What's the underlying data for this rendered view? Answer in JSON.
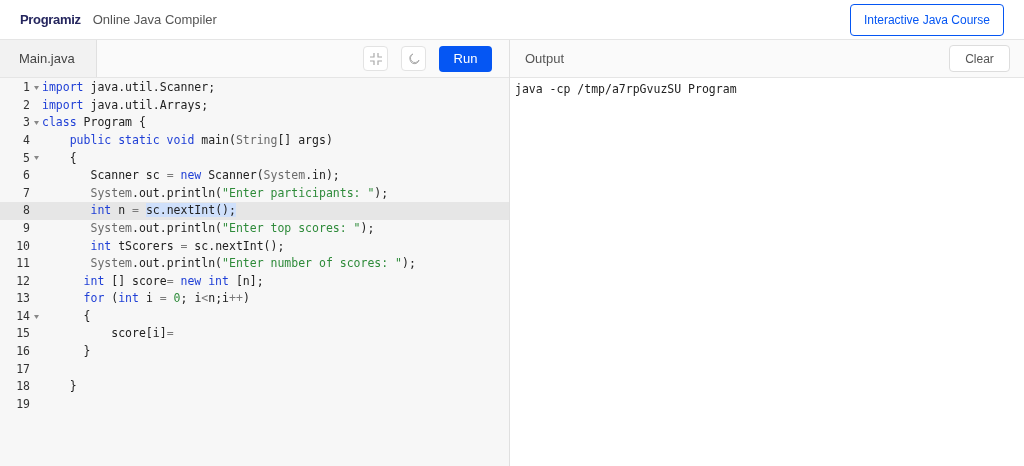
{
  "header": {
    "logo": "Programiz",
    "title": "Online Java Compiler",
    "course_button": "Interactive Java Course"
  },
  "editor": {
    "tab": "Main.java",
    "run_button": "Run",
    "lines": [
      {
        "number": "1",
        "foldable": true,
        "active": false,
        "tokens": [
          {
            "kind": "keyword",
            "text": "import"
          },
          {
            "kind": "plain",
            "text": " java.util.Scanner;"
          }
        ]
      },
      {
        "number": "2",
        "foldable": false,
        "active": false,
        "tokens": [
          {
            "kind": "keyword",
            "text": "import"
          },
          {
            "kind": "plain",
            "text": " java.util.Arrays;"
          }
        ]
      },
      {
        "number": "3",
        "foldable": true,
        "active": false,
        "tokens": [
          {
            "kind": "keyword",
            "text": "class"
          },
          {
            "kind": "plain",
            "text": " Program {"
          }
        ]
      },
      {
        "number": "4",
        "foldable": false,
        "active": false,
        "tokens": [
          {
            "kind": "keyword",
            "text": "    public static void"
          },
          {
            "kind": "plain",
            "text": " main("
          },
          {
            "kind": "builtin",
            "text": "String"
          },
          {
            "kind": "plain",
            "text": "[] args)"
          }
        ]
      },
      {
        "number": "5",
        "foldable": true,
        "active": false,
        "tokens": [
          {
            "kind": "plain",
            "text": "    {"
          }
        ]
      },
      {
        "number": "6",
        "foldable": false,
        "active": false,
        "tokens": [
          {
            "kind": "plain",
            "text": "       Scanner sc "
          },
          {
            "kind": "operator",
            "text": "= "
          },
          {
            "kind": "keyword",
            "text": "new"
          },
          {
            "kind": "plain",
            "text": " Scanner("
          },
          {
            "kind": "builtin",
            "text": "System"
          },
          {
            "kind": "plain",
            "text": ".in);"
          }
        ]
      },
      {
        "number": "7",
        "foldable": false,
        "active": false,
        "tokens": [
          {
            "kind": "builtin",
            "text": "       System"
          },
          {
            "kind": "plain",
            "text": ".out.println("
          },
          {
            "kind": "string",
            "text": "\"Enter participants: \""
          },
          {
            "kind": "plain",
            "text": ");"
          }
        ]
      },
      {
        "number": "8",
        "foldable": false,
        "active": true,
        "tokens": [
          {
            "kind": "keyword",
            "text": "       int"
          },
          {
            "kind": "plain",
            "text": " n "
          },
          {
            "kind": "operator",
            "text": "= "
          },
          {
            "kind": "selection",
            "text": "sc.nextInt();"
          }
        ]
      },
      {
        "number": "9",
        "foldable": false,
        "active": false,
        "tokens": [
          {
            "kind": "builtin",
            "text": "       System"
          },
          {
            "kind": "plain",
            "text": ".out.println("
          },
          {
            "kind": "string",
            "text": "\"Enter top scores: \""
          },
          {
            "kind": "plain",
            "text": ");"
          }
        ]
      },
      {
        "number": "10",
        "foldable": false,
        "active": false,
        "tokens": [
          {
            "kind": "keyword",
            "text": "       int"
          },
          {
            "kind": "plain",
            "text": " tScorers "
          },
          {
            "kind": "operator",
            "text": "="
          },
          {
            "kind": "plain",
            "text": " sc.nextInt();"
          }
        ]
      },
      {
        "number": "11",
        "foldable": false,
        "active": false,
        "tokens": [
          {
            "kind": "builtin",
            "text": "       System"
          },
          {
            "kind": "plain",
            "text": ".out.println("
          },
          {
            "kind": "string",
            "text": "\"Enter number of scores: \""
          },
          {
            "kind": "plain",
            "text": ");"
          }
        ]
      },
      {
        "number": "12",
        "foldable": false,
        "active": false,
        "tokens": [
          {
            "kind": "keyword",
            "text": "      int"
          },
          {
            "kind": "plain",
            "text": " [] score"
          },
          {
            "kind": "operator",
            "text": "= "
          },
          {
            "kind": "keyword",
            "text": "new int"
          },
          {
            "kind": "plain",
            "text": " [n];"
          }
        ]
      },
      {
        "number": "13",
        "foldable": false,
        "active": false,
        "tokens": [
          {
            "kind": "keyword",
            "text": "      for"
          },
          {
            "kind": "plain",
            "text": " ("
          },
          {
            "kind": "keyword",
            "text": "int"
          },
          {
            "kind": "plain",
            "text": " i "
          },
          {
            "kind": "operator",
            "text": "= "
          },
          {
            "kind": "string",
            "text": "0"
          },
          {
            "kind": "plain",
            "text": "; i"
          },
          {
            "kind": "operator",
            "text": "<"
          },
          {
            "kind": "plain",
            "text": "n;i"
          },
          {
            "kind": "operator",
            "text": "++"
          },
          {
            "kind": "plain",
            "text": ")"
          }
        ]
      },
      {
        "number": "14",
        "foldable": true,
        "active": false,
        "tokens": [
          {
            "kind": "plain",
            "text": "      {"
          }
        ]
      },
      {
        "number": "15",
        "foldable": false,
        "active": false,
        "tokens": [
          {
            "kind": "plain",
            "text": "          score[i]"
          },
          {
            "kind": "operator",
            "text": "="
          }
        ]
      },
      {
        "number": "16",
        "foldable": false,
        "active": false,
        "tokens": [
          {
            "kind": "plain",
            "text": "      }"
          }
        ]
      },
      {
        "number": "17",
        "foldable": false,
        "active": false
      },
      {
        "number": "18",
        "foldable": false,
        "active": false,
        "tokens": [
          {
            "kind": "plain",
            "text": "    }"
          }
        ]
      },
      {
        "number": "19",
        "foldable": false,
        "active": false
      }
    ]
  },
  "output": {
    "title": "Output",
    "clear_button": "Clear",
    "text": "java -cp /tmp/a7rpGvuzSU Program"
  }
}
